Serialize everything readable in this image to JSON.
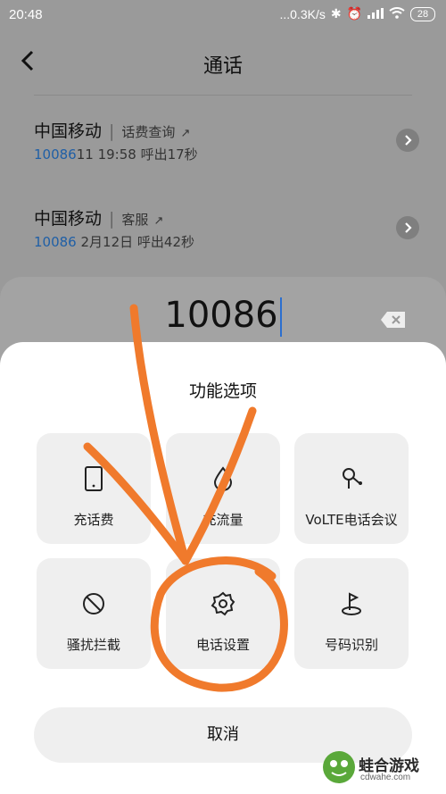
{
  "status": {
    "time": "20:48",
    "speed": "...0.3K/s",
    "battery": "28"
  },
  "header": {
    "title": "通话"
  },
  "calls": [
    {
      "name": "中国移动",
      "tag": "话费查询",
      "number": "10086",
      "date": "11 19:58",
      "detail": "呼出17秒"
    },
    {
      "name": "中国移动",
      "tag": "客服",
      "number": "10086",
      "date": "2月12日",
      "detail": "呼出42秒"
    }
  ],
  "dialer": {
    "number": "10086"
  },
  "sheet": {
    "title": "功能选项",
    "options": [
      {
        "label": "充话费",
        "icon": "phone-card-icon"
      },
      {
        "label": "充流量",
        "icon": "drop-icon"
      },
      {
        "label": "VoLTE电话会议",
        "icon": "conference-icon"
      },
      {
        "label": "骚扰拦截",
        "icon": "block-icon"
      },
      {
        "label": "电话设置",
        "icon": "gear-icon"
      },
      {
        "label": "号码识别",
        "icon": "location-flag-icon"
      }
    ],
    "cancel": "取消"
  },
  "watermark": {
    "name": "蛙合游戏",
    "url": "cdwahe.com"
  },
  "colors": {
    "annotation": "#f07a2c",
    "link": "#1f5fa6"
  }
}
